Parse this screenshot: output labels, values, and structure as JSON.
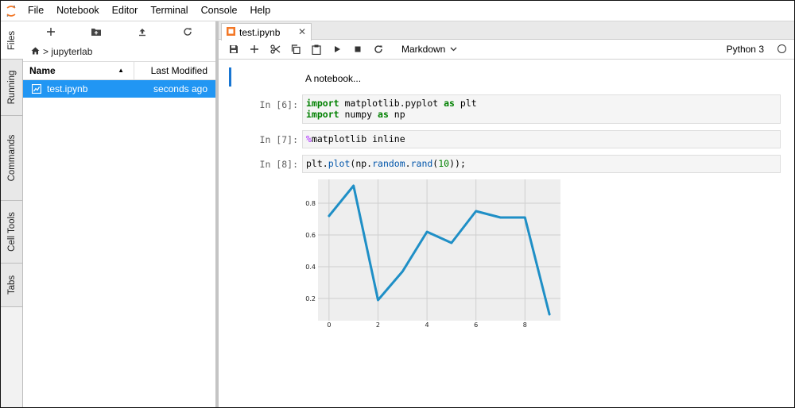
{
  "menubar": {
    "items": [
      "File",
      "Notebook",
      "Editor",
      "Terminal",
      "Console",
      "Help"
    ]
  },
  "side_tabs": [
    "Files",
    "Running",
    "Commands",
    "Cell Tools",
    "Tabs"
  ],
  "filebrowser": {
    "breadcrumb": "jupyterlab",
    "columns": {
      "name": "Name",
      "modified": "Last Modified"
    },
    "files": [
      {
        "name": "test.ipynb",
        "modified": "seconds ago"
      }
    ]
  },
  "notebook": {
    "tab_title": "test.ipynb",
    "cell_type": "Markdown",
    "kernel": "Python 3",
    "markdown_cell": "A notebook...",
    "cells": [
      {
        "prompt": "In [6]:",
        "lines": [
          "import matplotlib.pyplot as plt",
          "import numpy as np"
        ]
      },
      {
        "prompt": "In [7]:",
        "lines": [
          "%matplotlib inline"
        ]
      },
      {
        "prompt": "In [8]:",
        "lines": [
          "plt.plot(np.random.rand(10));"
        ]
      }
    ]
  },
  "chart_data": {
    "type": "line",
    "x": [
      0,
      1,
      2,
      3,
      4,
      5,
      6,
      7,
      8,
      9
    ],
    "series": [
      {
        "values": [
          0.72,
          0.91,
          0.19,
          0.37,
          0.62,
          0.55,
          0.75,
          0.71,
          0.71,
          0.1
        ],
        "color": "#1f8fc6"
      }
    ],
    "xticks": [
      "0",
      "2",
      "4",
      "6",
      "8"
    ],
    "yticks": [
      "0.2",
      "0.4",
      "0.6",
      "0.8"
    ],
    "xlim": [
      -0.45,
      9.45
    ],
    "ylim": [
      0.06,
      0.95
    ],
    "grid": true,
    "background": "#eeeeee"
  },
  "colors": {
    "accent": "#2196f3",
    "active_cell": "#1976d2"
  }
}
